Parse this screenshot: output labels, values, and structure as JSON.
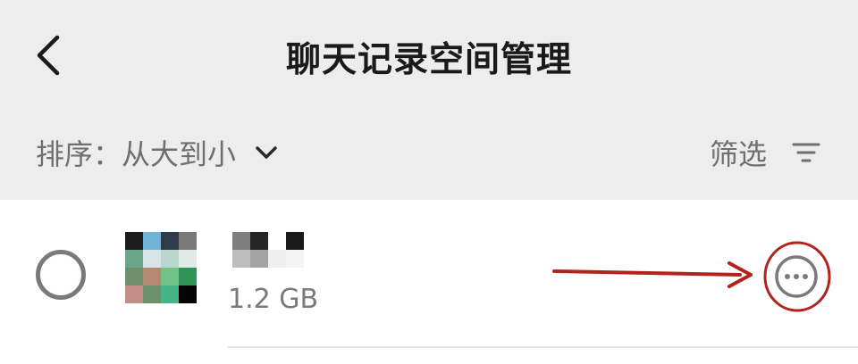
{
  "header": {
    "title": "聊天记录空间管理",
    "back_icon": "chevron-left-icon"
  },
  "toolbar": {
    "sort_label": "排序：",
    "sort_value": "从大到小",
    "sort_icon": "chevron-down-icon",
    "filter_label": "筛选",
    "filter_icon": "filter-lines-icon"
  },
  "list": {
    "items": [
      {
        "size": "1.2 GB",
        "avatar_colors": [
          "#1c1c1c",
          "#6fb4d8",
          "#2e3b4a",
          "#7a7a7a",
          "#6aa68c",
          "#d8e4ea",
          "#b9d7cc",
          "#e1ece6",
          "#6f8f6b",
          "#b5886f",
          "#71c488",
          "#2f9456",
          "#c58f89",
          "#6d8f6c",
          "#46b487",
          "#050505"
        ],
        "name_colors": [
          "#7f7f7f",
          "#262626",
          "#ffffff",
          "#1a1a1a",
          "#bdbdbd",
          "#a3a3a3",
          "#efefef",
          "#f3f3f3"
        ],
        "more_icon": "more-horizontal-icon"
      }
    ]
  },
  "colors": {
    "background": "#ededed",
    "list_background": "#ffffff",
    "annotation": "#b2231d",
    "muted_text": "#6f6f6f"
  }
}
